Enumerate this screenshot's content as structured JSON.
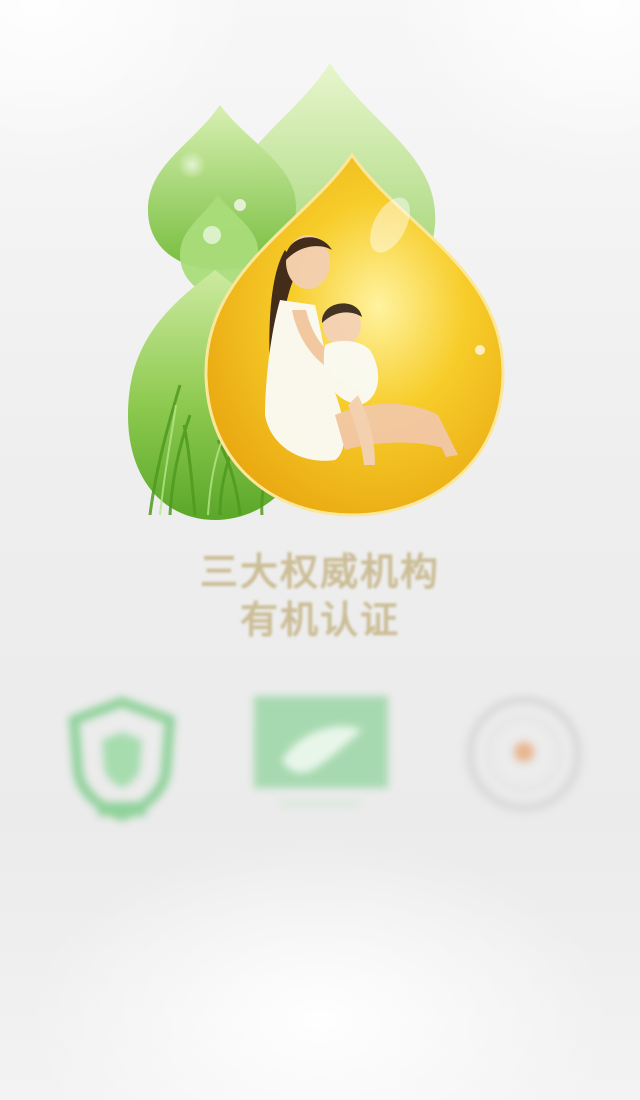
{
  "headline": {
    "line1": "三大权威机构",
    "line2": "有机认证"
  },
  "hero": {
    "icon": "oil-drop-mother-child-icon",
    "colors": {
      "green_light": "#cdeaa0",
      "green_mid": "#8cc94e",
      "green_dark": "#5aa72a",
      "gold_light": "#fff3a0",
      "gold_mid": "#f7cd2a",
      "gold_dark": "#e9a811"
    }
  },
  "certifications": [
    {
      "icon": "shield-certification-icon",
      "name": "",
      "sub": "",
      "color": "#8fd19a"
    },
    {
      "icon": "organic-label-icon",
      "name": "",
      "sub": "",
      "color": "#8fd19a"
    },
    {
      "icon": "round-seal-icon",
      "name": "",
      "sub": "",
      "color": "#e8b58f"
    }
  ],
  "colors": {
    "headline": "#c9b98f",
    "caption": "#b9b9b9",
    "background": "#efefef"
  }
}
